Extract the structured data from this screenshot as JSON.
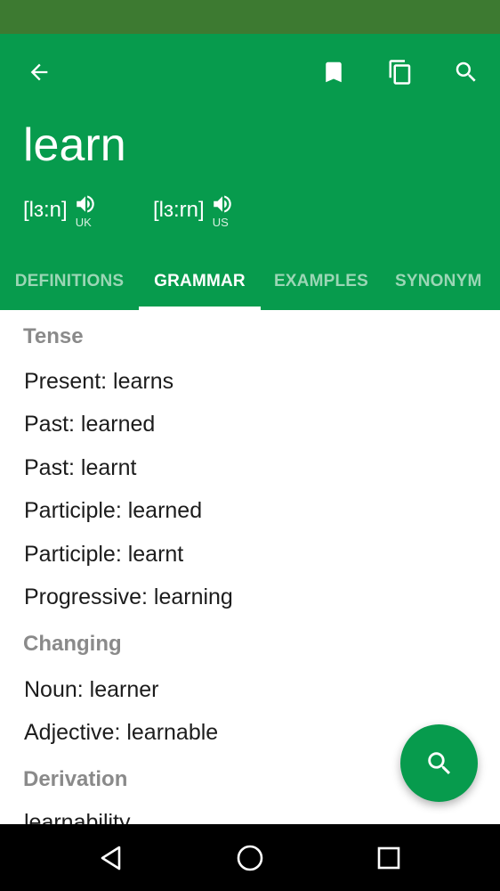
{
  "colors": {
    "status_bar": "#3d7a31",
    "primary": "#079b4d",
    "tab_inactive": "#9bd6b5",
    "section_title": "#8a8a8a",
    "nav_bar": "#000000"
  },
  "toolbar": {
    "back_icon": "arrow-left-icon",
    "bookmark_icon": "bookmark-icon",
    "copy_icon": "copy-icon",
    "search_icon": "search-icon"
  },
  "word": "learn",
  "pronunciations": [
    {
      "ipa": "[lɜ:n]",
      "region": "UK"
    },
    {
      "ipa": "[lɜ:rn]",
      "region": "US"
    }
  ],
  "tabs": [
    {
      "label": "DEFINITIONS",
      "active": false
    },
    {
      "label": "GRAMMAR",
      "active": true
    },
    {
      "label": "EXAMPLES",
      "active": false
    },
    {
      "label": "SYNONYM",
      "active": false
    }
  ],
  "sections": [
    {
      "title": "Tense",
      "items": [
        "Present: learns",
        "Past: learned",
        "Past: learnt",
        "Participle: learned",
        "Participle: learnt",
        "Progressive: learning"
      ]
    },
    {
      "title": "Changing",
      "items": [
        "Noun: learner",
        "Adjective: learnable"
      ]
    },
    {
      "title": "Derivation",
      "items": [
        "learnability"
      ]
    }
  ],
  "fab": {
    "icon": "search-icon"
  },
  "nav": {
    "back_icon": "nav-back-icon",
    "home_icon": "nav-home-icon",
    "recents_icon": "nav-recents-icon"
  }
}
